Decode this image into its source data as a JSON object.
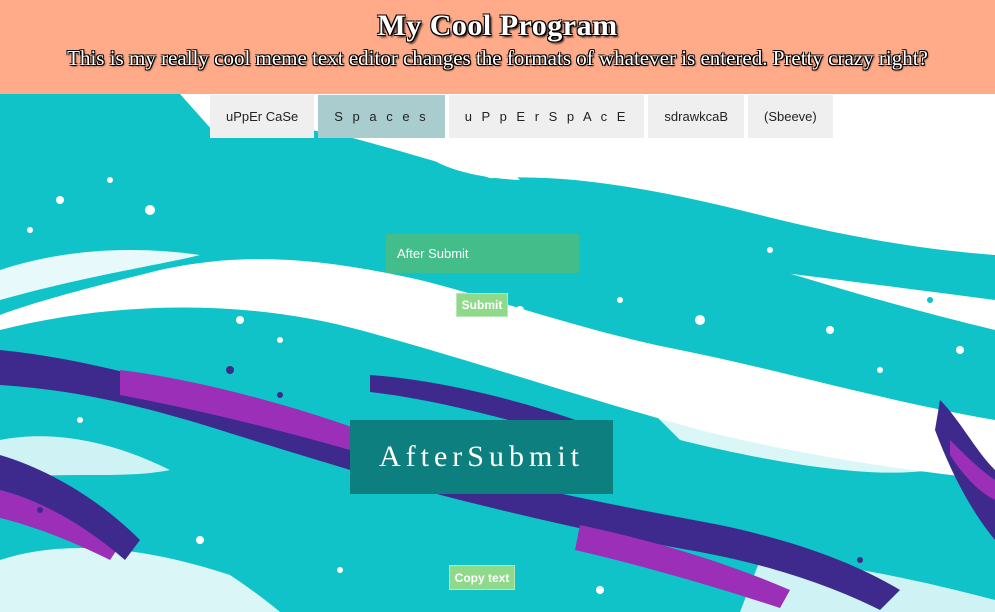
{
  "header": {
    "title": "My Cool Program",
    "subtitle": "This is my really cool meme text editor changes the formats of whatever is entered. Pretty crazy right?"
  },
  "tabs": [
    {
      "label": "uPpEr CaSe",
      "active": false
    },
    {
      "label": "S p a c e s",
      "active": true
    },
    {
      "label": "u P p E r S p A c E",
      "active": false
    },
    {
      "label": "sdrawkcaB",
      "active": false
    },
    {
      "label": "(Sbeeve)",
      "active": false
    }
  ],
  "input": {
    "value": "After Submit"
  },
  "submit": {
    "label": "Submit"
  },
  "output": {
    "text": "AfterSubmit"
  },
  "copy": {
    "label": "Copy text"
  },
  "colors": {
    "header_bg": "#ffa884",
    "tab_bg": "#efefef",
    "tab_active_bg": "#a9cccf",
    "input_bg": "#43bd8a",
    "button_bg": "#8fd98a",
    "output_bg": "#0e7f7f",
    "teal": "#0fc3c9",
    "purple": "#3d2a8c",
    "magenta": "#9b2fb8"
  }
}
